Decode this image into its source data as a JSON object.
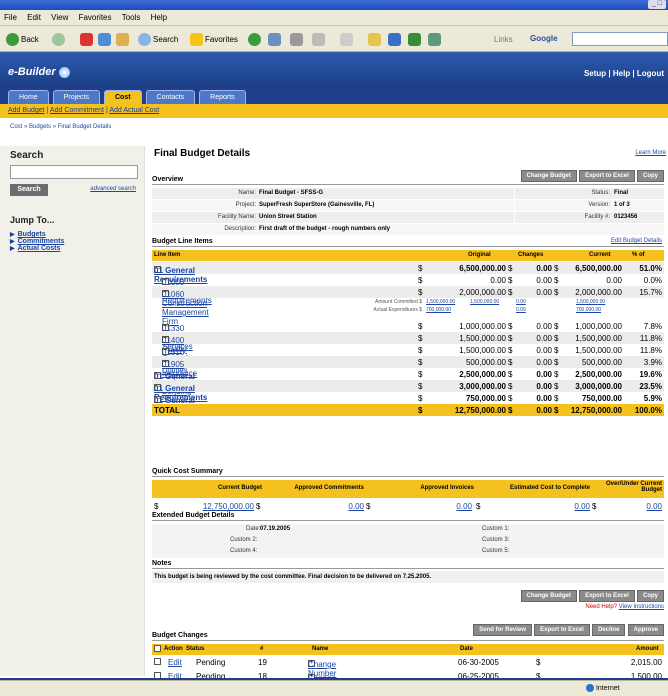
{
  "browser": {
    "menu": [
      "File",
      "Edit",
      "View",
      "Favorites",
      "Tools",
      "Help"
    ],
    "toolbar": {
      "back": "Back",
      "search": "Search",
      "favorites": "Favorites",
      "links": "Links",
      "google": "Google"
    },
    "status_zone": "Internet"
  },
  "app": {
    "brand": "e-Builder",
    "top_links": "Setup | Help | Logout",
    "tabs": [
      "Home",
      "Projects",
      "Cost",
      "Contacts",
      "Reports"
    ],
    "active_tab": "Cost",
    "subnav": [
      "Add Budget",
      "Add Commitment",
      "Add Actual Cost"
    ],
    "breadcrumb": "Cost » Budgets » Final Budget Details"
  },
  "sidebar": {
    "search_title": "Search",
    "search_button": "Search",
    "advanced": "advanced search",
    "jump_title": "Jump To...",
    "links": [
      "Budgets",
      "Commitments",
      "Actual Costs"
    ]
  },
  "main": {
    "title": "Final Budget Details",
    "learn_more": "Learn More",
    "overview_title": "Overview",
    "buttons": [
      "Change Budget",
      "Export to Excel",
      "Copy"
    ],
    "overview": {
      "name_label": "Name:",
      "name": "Final Budget - SFSS-G",
      "project_label": "Project:",
      "project": "SuperFresh SuperStore (Gainesville, FL)",
      "facility_label": "Facility Name:",
      "facility": "Union Street Station",
      "desc_label": "Description:",
      "desc": "First draft of the budget - rough numbers only",
      "status_label": "Status:",
      "status": "Final",
      "version_label": "Version:",
      "version": "1 of 3",
      "facnum_label": "Facility #:",
      "facnum": "0123456"
    },
    "line_items_title": "Budget Line Items",
    "edit_details": "Edit Budget Details",
    "li_headers": [
      "Line Item",
      "Original",
      "Changes",
      "Current",
      "% of"
    ],
    "line_items": [
      {
        "name": "01 General Requirements",
        "orig": "6,500,000.00",
        "chg": "0.00",
        "cur": "6,500,000.00",
        "pct": "51.0%",
        "bold": true
      },
      {
        "name": "01000 General Requirements",
        "orig": "0.00",
        "chg": "0.00",
        "cur": "0.00",
        "pct": "0.0%",
        "bold": false
      },
      {
        "name": "01060 Construction Management Firm",
        "orig": "2,000,000.00",
        "chg": "0.00",
        "cur": "2,000,000.00",
        "pct": "15.7%",
        "bold": false
      },
      {
        "name": "01330 Engineering Services",
        "orig": "1,000,000.00",
        "chg": "0.00",
        "cur": "1,000,000.00",
        "pct": "7.8%",
        "bold": false
      },
      {
        "name": "01400 Quality Control",
        "orig": "1,500,000.00",
        "chg": "0.00",
        "cur": "1,500,000.00",
        "pct": "11.8%",
        "bold": false
      },
      {
        "name": "01510 Temporary Utilities",
        "orig": "1,500,000.00",
        "chg": "0.00",
        "cur": "1,500,000.00",
        "pct": "11.8%",
        "bold": false
      },
      {
        "name": "01905 Insurance and Bonding",
        "orig": "500,000.00",
        "chg": "0.00",
        "cur": "500,000.00",
        "pct": "3.9%",
        "bold": false
      },
      {
        "name": "01 General Requirements",
        "orig": "2,500,000.00",
        "chg": "0.00",
        "cur": "2,500,000.00",
        "pct": "19.6%",
        "bold": true
      },
      {
        "name": "01 General Requirements",
        "orig": "3,000,000.00",
        "chg": "0.00",
        "cur": "3,000,000.00",
        "pct": "23.5%",
        "bold": true
      },
      {
        "name": "01 General Requirements",
        "orig": "750,000.00",
        "chg": "0.00",
        "cur": "750,000.00",
        "pct": "5.9%",
        "bold": true
      }
    ],
    "sub_details": {
      "committed_label": "Amount Committed $",
      "committed": [
        "1,500,000.00",
        "1,500,000.00",
        "0.00",
        "1,500,000.00"
      ],
      "actual_label": "Actual Expenditures $",
      "actual": [
        "700,000.00",
        "0.00",
        "700,000.00"
      ]
    },
    "total": {
      "label": "TOTAL",
      "orig": "12,750,000.00",
      "chg": "0.00",
      "cur": "12,750,000.00",
      "pct": "100.0%"
    },
    "qcs_title": "Quick Cost Summary",
    "qcs_headers": [
      "Current Budget",
      "Approved Commitments",
      "Approved Invoices",
      "Estimated Cost to Complete",
      "Over/Under Current Budget"
    ],
    "qcs_values": [
      "12,750,000.00",
      "0.00",
      "0.00",
      "0.00",
      "0.00"
    ],
    "ext_title": "Extended Budget Details",
    "ext": {
      "date_label": "Date:",
      "date": "07.19.2005",
      "c2": "Custom 2:",
      "c4": "Custom 4:",
      "c1": "Custom 1:",
      "c3": "Custom 3:",
      "c5": "Custom 5:"
    },
    "notes_title": "Notes",
    "notes": "This budget is being reviewed by the cost committee. Final decision to be delivered on 7.25.2005.",
    "help": "Need Help?",
    "view_instructions": "View Instructions",
    "changes_title": "Budget Changes",
    "change_buttons": [
      "Send for Review",
      "Export to Excel",
      "Decline",
      "Approve"
    ],
    "change_headers": [
      "Action",
      "Status",
      "#",
      "Name",
      "Date",
      "Amount"
    ],
    "changes": [
      {
        "action": "Edit",
        "status": "Pending",
        "num": "19",
        "name": "Change Number 19",
        "date": "06-30-2005",
        "amount": "2,015.00"
      },
      {
        "action": "Edit",
        "status": "Pending",
        "num": "18",
        "name": "Change Number 18",
        "date": "06-25-2005",
        "amount": "1,500.00"
      }
    ]
  }
}
